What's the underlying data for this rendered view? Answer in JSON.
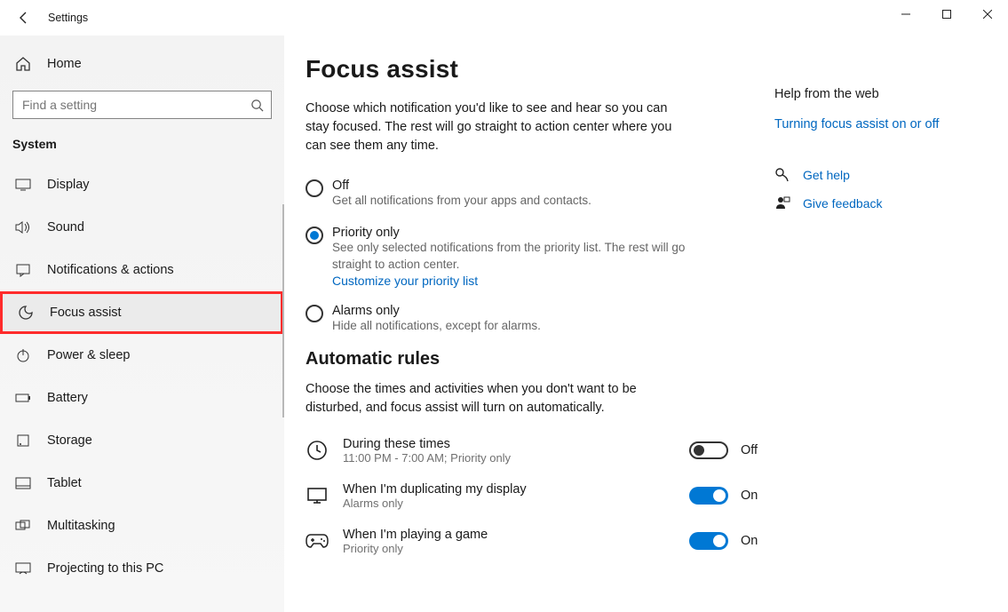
{
  "window": {
    "title": "Settings"
  },
  "sidebar": {
    "home": "Home",
    "search_placeholder": "Find a setting",
    "group": "System",
    "items": [
      {
        "label": "Display"
      },
      {
        "label": "Sound"
      },
      {
        "label": "Notifications & actions"
      },
      {
        "label": "Focus assist"
      },
      {
        "label": "Power & sleep"
      },
      {
        "label": "Battery"
      },
      {
        "label": "Storage"
      },
      {
        "label": "Tablet"
      },
      {
        "label": "Multitasking"
      },
      {
        "label": "Projecting to this PC"
      }
    ]
  },
  "page": {
    "title": "Focus assist",
    "intro": "Choose which notification you'd like to see and hear so you can stay focused. The rest will go straight to action center where you can see them any time.",
    "options": {
      "off": {
        "label": "Off",
        "sub": "Get all notifications from your apps and contacts."
      },
      "priority": {
        "label": "Priority only",
        "sub": "See only selected notifications from the priority list. The rest will go straight to action center.",
        "link": "Customize your priority list"
      },
      "alarms": {
        "label": "Alarms only",
        "sub": "Hide all notifications, except for alarms."
      }
    },
    "auto_title": "Automatic rules",
    "auto_desc": "Choose the times and activities when you don't want to be disturbed, and focus assist will turn on automatically.",
    "rules": {
      "times": {
        "label": "During these times",
        "sub": "11:00 PM - 7:00 AM; Priority only",
        "state": "Off"
      },
      "display": {
        "label": "When I'm duplicating my display",
        "sub": "Alarms only",
        "state": "On"
      },
      "game": {
        "label": "When I'm playing a game",
        "sub": "Priority only",
        "state": "On"
      }
    }
  },
  "right": {
    "head": "Help from the web",
    "link1": "Turning focus assist on or off",
    "help": "Get help",
    "feedback": "Give feedback"
  }
}
